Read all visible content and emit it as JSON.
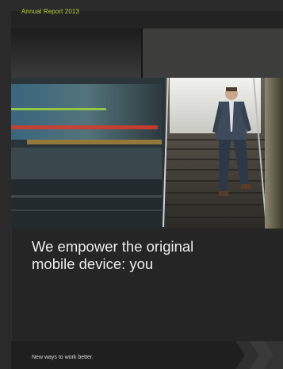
{
  "cover": {
    "report_label": "Annual Report 2013",
    "headline_line1": "We empower the original",
    "headline_line2": "mobile device: you",
    "tagline": "New ways to work better."
  },
  "colors": {
    "background": "#2a2a2a",
    "accent_label": "#b5cc3c",
    "headline": "#ececec"
  }
}
